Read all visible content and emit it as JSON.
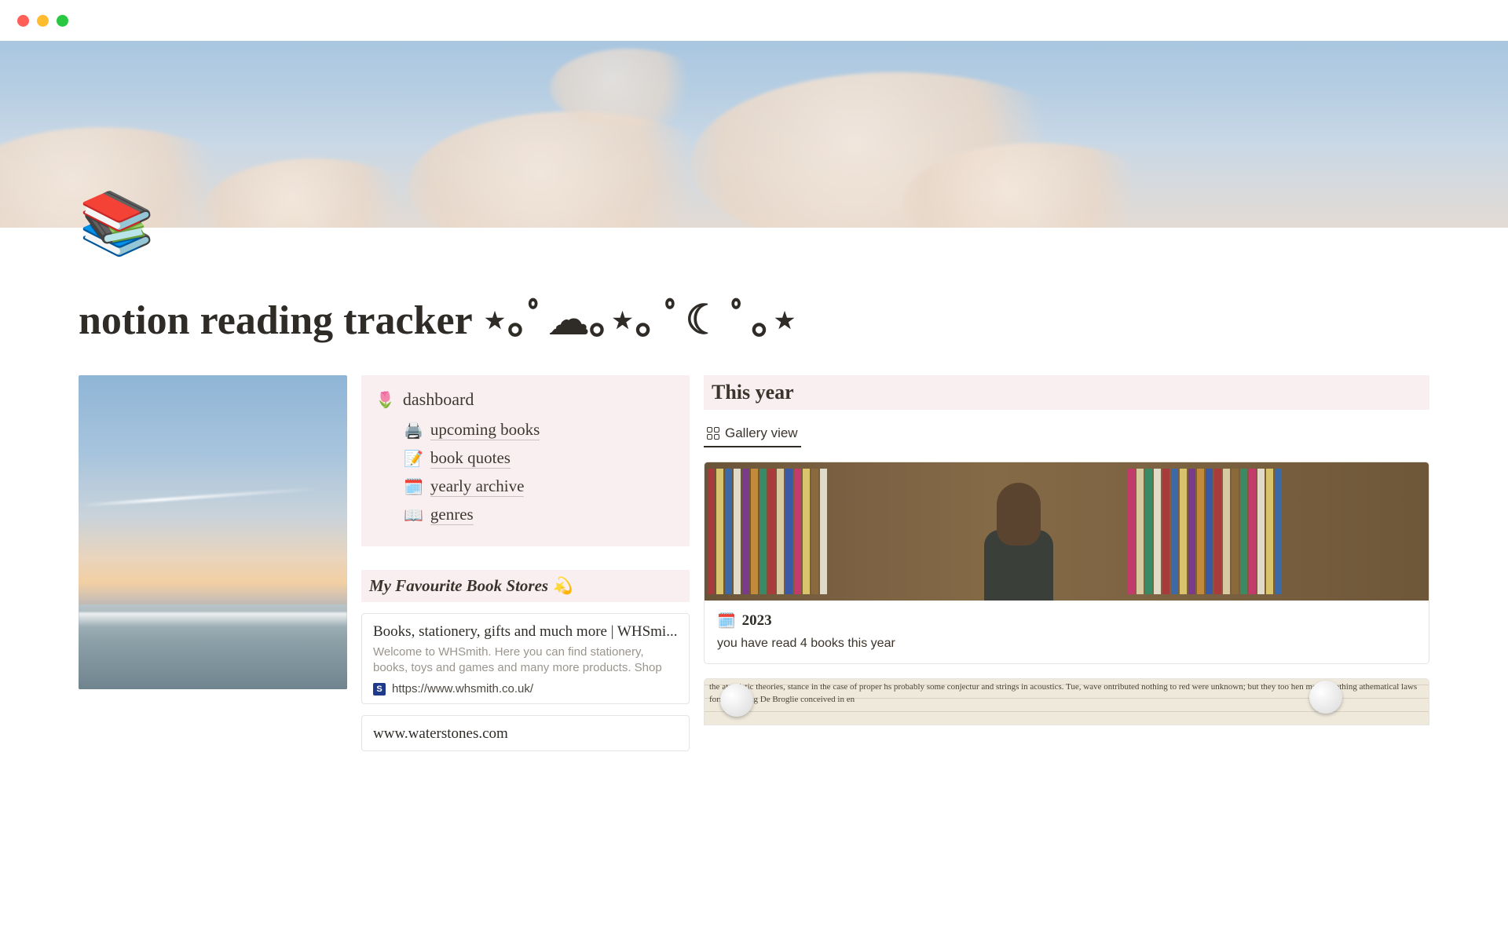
{
  "page_icon": "📚",
  "page_title": "notion reading tracker ⋆｡ﾟ☁︎｡⋆｡ ﾟ☾ ﾟ｡⋆",
  "dashboard": {
    "icon": "🌷",
    "label": "dashboard",
    "items": [
      {
        "icon": "🖨️",
        "label": "upcoming books"
      },
      {
        "icon": "📝",
        "label": "book quotes"
      },
      {
        "icon": "🗓️",
        "label": "yearly archive"
      },
      {
        "icon": "📖",
        "label": "genres"
      }
    ]
  },
  "favourites": {
    "heading": "My Favourite Book Stores 💫",
    "bookmarks": [
      {
        "title": "Books, stationery, gifts and much more | WHSmi...",
        "desc": "Welcome to WHSmith. Here you can find stationery, books, toys and games and many more products. Shop",
        "favicon_letter": "S",
        "url": "https://www.whsmith.co.uk/"
      },
      {
        "title": "www.waterstones.com",
        "desc": "",
        "favicon_letter": "",
        "url": ""
      }
    ]
  },
  "this_year": {
    "heading": "This year",
    "view_label": "Gallery view",
    "cards": [
      {
        "icon": "🗓️",
        "title": "2023",
        "subtitle": "you have read 4 books this year"
      }
    ],
    "peek_text": "the atomistic theories, stance in the case of proper hs probably some conjectur and strings in acoustics. Tue, wave ontributed nothing to red were unknown; but they too hen mena. Nothing athematical laws formulated ng De Broglie conceived in en"
  }
}
